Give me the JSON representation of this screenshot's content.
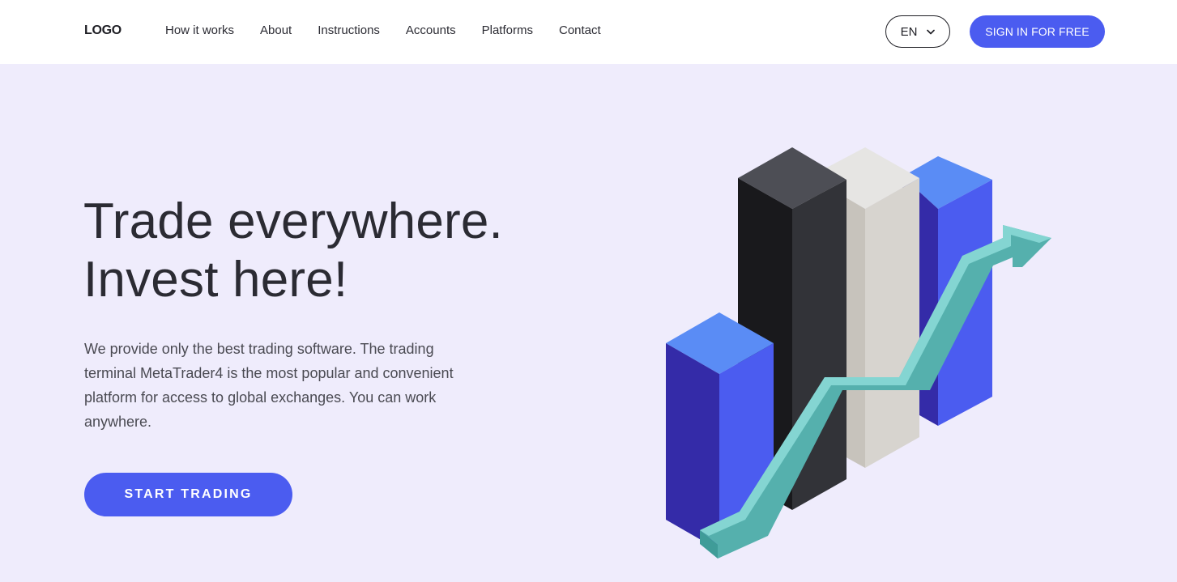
{
  "header": {
    "logo": "LOGO",
    "nav": [
      {
        "label": "How it works"
      },
      {
        "label": "About"
      },
      {
        "label": "Instructions"
      },
      {
        "label": "Accounts"
      },
      {
        "label": "Platforms"
      },
      {
        "label": "Contact"
      }
    ],
    "language": "EN",
    "signin_label": "SIGN IN FOR FREE"
  },
  "hero": {
    "title_line1": "Trade everywhere.",
    "title_line2": "Invest here!",
    "description": "We provide only the best trading software. The trading terminal MetaTrader4 is the most popular and convenient platform for access to global exchanges. You can work anywhere.",
    "cta_label": "START TRADING"
  },
  "colors": {
    "accent": "#4b5cf0",
    "background": "#efecfc",
    "arrow": "#55b0ad"
  },
  "icons": {
    "language_chevron": "chevron-down-icon",
    "illustration": "growth-chart-illustration"
  }
}
